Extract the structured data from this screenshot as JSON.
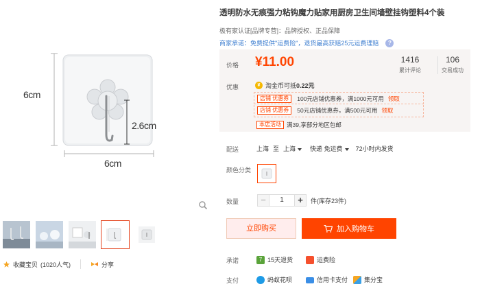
{
  "gallery": {
    "dimension_height": "6cm",
    "dimension_width": "6cm",
    "dimension_hook": "2.6cm",
    "favorite_label": "收藏宝贝",
    "favorite_count": "(1020人气)",
    "share_label": "分享"
  },
  "product": {
    "title": "透明防水无痕强力粘钩魔力贴家用厨房卫生间墙壁挂钩塑料4个装",
    "auth_line": "极有家认证[品牌专营]：品牌授权、正品保障",
    "promise_line": "商家承诺：免费提供\"运费险\"，退货最高获赔25元运费理赔"
  },
  "price": {
    "label": "价格",
    "value": "¥11.00",
    "reviews_count": "1416",
    "reviews_label": "累计评论",
    "sales_count": "106",
    "sales_label": "交易成功"
  },
  "promo": {
    "label": "优惠",
    "coin_text": "淘金币可抵",
    "coin_amount": "0.22元",
    "coupons": [
      {
        "tag": "店铺 优惠券",
        "text": "100元店铺优惠券，满1000元可用",
        "claim": "领取"
      },
      {
        "tag": "店铺 优惠券",
        "text": "50元店铺优惠券，满500元可用",
        "claim": "领取"
      }
    ],
    "activity_tag": "本店活动",
    "activity_text": "满39,享部分地区包邮"
  },
  "delivery": {
    "label": "配送",
    "from": "上海",
    "to_word": "至",
    "to": "上海",
    "shipping": "快递 免运费",
    "dispatch": "72小时内发货"
  },
  "variant": {
    "label": "颜色分类"
  },
  "quantity": {
    "label": "数量",
    "value": "1",
    "stock": "件(库存23件)",
    "minus": "−",
    "plus": "+"
  },
  "actions": {
    "buy_now": "立即购买",
    "add_to_cart": "加入购物车"
  },
  "services": {
    "promise_label": "承诺",
    "return_7day": "15天退货",
    "freight_insurance": "运费险",
    "pay_label": "支付",
    "huabei": "蚂蚁花呗",
    "credit_card": "信用卡支付",
    "jifenbao": "集分宝"
  },
  "colors": {
    "accent": "#ff4400",
    "link": "#3f7fd0",
    "price_bg": "#f7f4f3"
  }
}
